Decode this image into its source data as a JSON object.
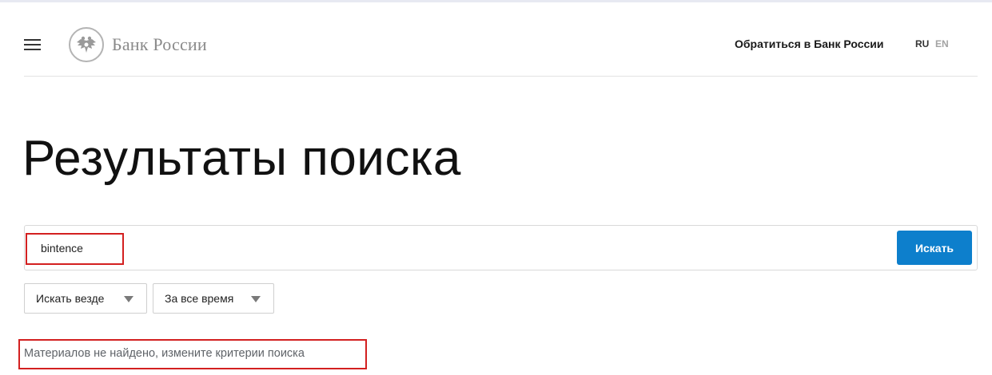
{
  "header": {
    "logo_text": "Банк России",
    "contact_link": "Обратиться в Банк России",
    "languages": [
      {
        "code": "RU",
        "active": true
      },
      {
        "code": "EN",
        "active": false
      }
    ]
  },
  "main": {
    "title": "Результаты поиска",
    "search": {
      "value": "bintence",
      "button_label": "Искать"
    },
    "filters": [
      {
        "selected": "Искать везде"
      },
      {
        "selected": "За все время"
      }
    ],
    "message": "Материалов не найдено, измените критерии поиска"
  },
  "colors": {
    "accent": "#0d7fcc",
    "highlight": "#d32020"
  }
}
